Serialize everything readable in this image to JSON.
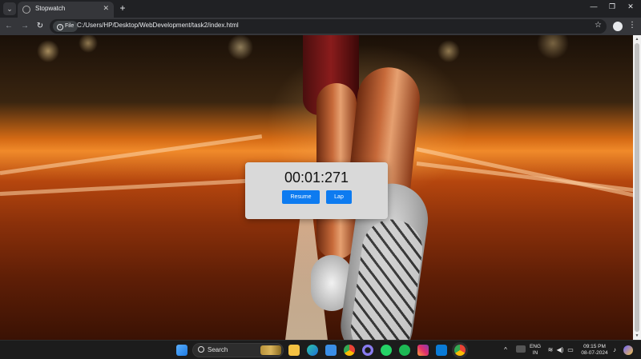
{
  "browser": {
    "tab_title": "Stopwatch",
    "tab_close": "✕",
    "new_tab": "+",
    "tab_search_glyph": "⌄",
    "window_controls": {
      "minimize": "—",
      "restore": "❐",
      "close": "✕"
    },
    "nav": {
      "back": "←",
      "forward": "→",
      "reload": "↻"
    },
    "chip_label": "File",
    "chip_icon": "i",
    "url": "C:/Users/HP/Desktop/WebDevelopment/task2/index.html",
    "bookmark_glyph": "☆",
    "menu_glyph": "⋮"
  },
  "stopwatch": {
    "time": "00:01:271",
    "resume_label": "Resume",
    "lap_label": "Lap"
  },
  "scrollbar": {
    "up": "▲",
    "down": "▼"
  },
  "taskbar": {
    "search_label": "Search",
    "language": "ENG",
    "region": "IN",
    "time": "09:15 PM",
    "date": "08-07-2024",
    "tray": {
      "chevron": "^",
      "wifi": "≋",
      "volume": "◀)",
      "battery": "▭",
      "bell": "♪"
    }
  },
  "colors": {
    "accent_button": "#0d7bf0",
    "card": "#d9d9d9",
    "browser_dark": "#202124",
    "toolbar": "#35363a"
  }
}
